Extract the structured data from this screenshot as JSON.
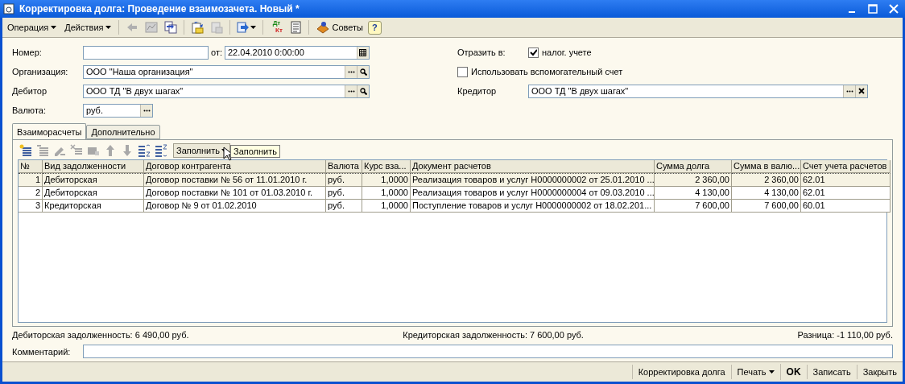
{
  "window": {
    "title": "Корректировка долга: Проведение взаимозачета. Новый *"
  },
  "toolbar": [
    {
      "kind": "menu",
      "label": "Операция"
    },
    {
      "kind": "menu",
      "label": "Действия"
    },
    {
      "kind": "sep"
    },
    {
      "kind": "icon"
    },
    {
      "kind": "icon"
    },
    {
      "kind": "icon"
    },
    {
      "kind": "sep"
    },
    {
      "kind": "icon"
    },
    {
      "kind": "icon"
    },
    {
      "kind": "sep"
    },
    {
      "kind": "dropicon"
    },
    {
      "kind": "sep"
    },
    {
      "kind": "dtkt",
      "top": "Дт",
      "bottom": "Кт"
    },
    {
      "kind": "icon"
    },
    {
      "kind": "sep"
    },
    {
      "kind": "tips",
      "label": "Советы"
    },
    {
      "kind": "help",
      "label": "?"
    }
  ],
  "form": {
    "number": {
      "label": "Номер:"
    },
    "date": {
      "label": "от:",
      "value": "22.04.2010  0:00:00"
    },
    "organization": {
      "label": "Организация:",
      "value": "ООО \"Наша организация\""
    },
    "debtor": {
      "label": "Дебитор",
      "value": "ООО ТД \"В двух шагах\""
    },
    "currency": {
      "label": "Валюта:",
      "value": "руб."
    },
    "reflect": {
      "label": "Отразить в:",
      "checkbox": {
        "label": "налог. учете",
        "checked": true
      }
    },
    "aux_account": {
      "label": "Использовать вспомогательный счет",
      "checked": false
    },
    "creditor": {
      "label": "Кредитор",
      "value": "ООО ТД \"В двух шагах\""
    }
  },
  "tabs": [
    {
      "label": "Взаиморасчеты",
      "selected": true
    },
    {
      "label": "Дополнительно",
      "selected": false
    }
  ],
  "table_toolbar": {
    "fill_button": "Заполнить",
    "tooltip": "Заполнить"
  },
  "table": {
    "columns": [
      "№",
      "Вид задолженности",
      "Договор контрагента",
      "Валюта",
      "Курс вза...",
      "Документ расчетов",
      "Сумма  долга",
      "Сумма в валю...",
      "Счет учета расчетов"
    ],
    "rows": [
      {
        "selected": true,
        "cells": [
          "1",
          "Дебиторская",
          "Договор поставки № 56 от 11.01.2010 г.",
          "руб.",
          "1,0000",
          "Реализация товаров и услуг Н0000000002 от 25.01.2010 ...",
          "2 360,00",
          "2 360,00",
          "62.01"
        ]
      },
      {
        "selected": false,
        "cells": [
          "2",
          "Дебиторская",
          "Договор поставки № 101 от 01.03.2010 г.",
          "руб.",
          "1,0000",
          "Реализация товаров и услуг Н0000000004 от 09.03.2010 ...",
          "4 130,00",
          "4 130,00",
          "62.01"
        ]
      },
      {
        "selected": false,
        "cells": [
          "3",
          "Кредиторская",
          "Договор № 9 от 01.02.2010",
          "руб.",
          "1,0000",
          "Поступление товаров и услуг Н0000000002 от 18.02.201...",
          "7 600,00",
          "7 600,00",
          "60.01"
        ]
      }
    ]
  },
  "totals": [
    "Дебиторская задолженность: 6 490,00 руб.",
    "Кредиторская задолженность: 7 600,00 руб.",
    "Разница: -1 110,00 руб."
  ],
  "comment": {
    "label": "Комментарий:"
  },
  "bottom_buttons": [
    {
      "kind": "plain",
      "label": "Корректировка долга"
    },
    {
      "kind": "menu",
      "label": "Печать"
    },
    {
      "kind": "bold",
      "label": "OK"
    },
    {
      "kind": "plain",
      "label": "Записать"
    },
    {
      "kind": "plain",
      "label": "Закрыть"
    }
  ]
}
